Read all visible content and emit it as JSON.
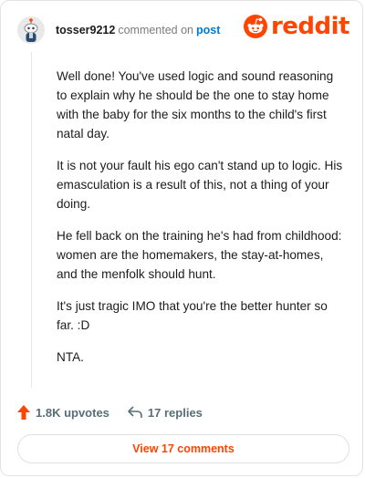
{
  "header": {
    "username": "tosser9212",
    "action_text": "commented on",
    "post_link": "post",
    "avatar_icon": "snoo-avatar-icon"
  },
  "brand": {
    "wordmark": "reddit",
    "logo_icon": "reddit-snoo-icon",
    "accent": "#ff4500"
  },
  "comment": {
    "paragraphs": [
      "Well done! You've used logic and sound reasoning to explain why he should be the one to stay home with the baby for the six months to the child's first natal day.",
      "It is not your fault his ego can't stand up to logic. His emasculation is a result of this, not a thing of your doing.",
      "He fell back on the training he's had from childhood: women are the homemakers, the stay-at-homes, and the menfolk should hunt.",
      "It's just tragic IMO that you're the better hunter so far. :D",
      "NTA."
    ]
  },
  "actions": {
    "upvotes_label": "1.8K upvotes",
    "upvote_icon": "upvote-arrow-icon",
    "replies_label": "17 replies",
    "reply_icon": "reply-arrow-icon"
  },
  "footer": {
    "view_comments_label": "View 17 comments"
  }
}
